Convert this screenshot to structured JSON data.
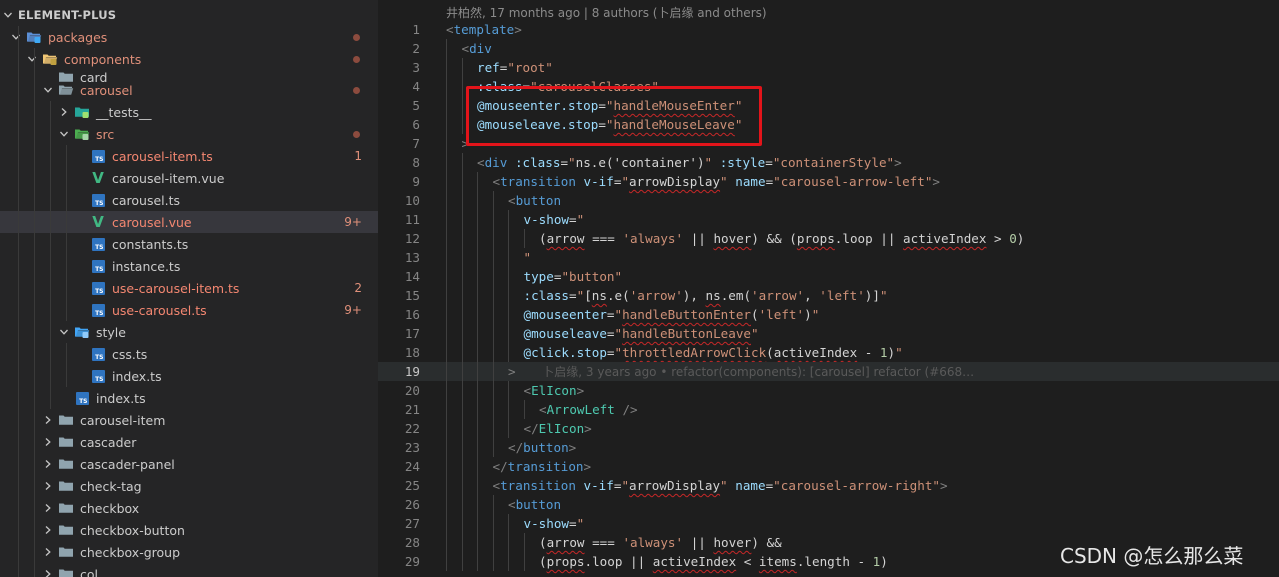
{
  "explorer": {
    "rows": [
      {
        "label": "ELEMENT-PLUS",
        "type": "root",
        "depth": 0,
        "chevron": "down",
        "icon": "none",
        "status": "none",
        "badge": ""
      },
      {
        "label": "packages",
        "type": "folder",
        "depth": 1,
        "chevron": "down",
        "icon": "folder-packages-icon",
        "status": "modified",
        "badge": "dot"
      },
      {
        "label": "components",
        "type": "folder",
        "depth": 2,
        "chevron": "down",
        "icon": "folder-components-icon",
        "status": "modified",
        "badge": "dot"
      },
      {
        "label": "card",
        "type": "folder",
        "depth": 3,
        "chevron": "none",
        "icon": "folder-icon",
        "status": "none",
        "badge": ""
      },
      {
        "label": "carousel",
        "type": "folder",
        "depth": 3,
        "chevron": "down",
        "icon": "folder-open-icon",
        "status": "modified",
        "badge": "dot"
      },
      {
        "label": "__tests__",
        "type": "folder",
        "depth": 4,
        "chevron": "right",
        "icon": "folder-tests-icon",
        "status": "none",
        "badge": ""
      },
      {
        "label": "src",
        "type": "folder",
        "depth": 4,
        "chevron": "down",
        "icon": "folder-src-icon",
        "status": "modified",
        "badge": "dot"
      },
      {
        "label": "carousel-item.ts",
        "type": "file",
        "depth": 5,
        "chevron": "none",
        "icon": "ts-icon",
        "status": "error",
        "badge": "1"
      },
      {
        "label": "carousel-item.vue",
        "type": "file",
        "depth": 5,
        "chevron": "none",
        "icon": "vue-icon",
        "status": "none",
        "badge": ""
      },
      {
        "label": "carousel.ts",
        "type": "file",
        "depth": 5,
        "chevron": "none",
        "icon": "ts-icon",
        "status": "none",
        "badge": ""
      },
      {
        "label": "carousel.vue",
        "type": "file",
        "depth": 5,
        "chevron": "none",
        "icon": "vue-icon",
        "status": "error",
        "badge": "9+",
        "selected": true
      },
      {
        "label": "constants.ts",
        "type": "file",
        "depth": 5,
        "chevron": "none",
        "icon": "ts-icon",
        "status": "none",
        "badge": ""
      },
      {
        "label": "instance.ts",
        "type": "file",
        "depth": 5,
        "chevron": "none",
        "icon": "ts-icon",
        "status": "none",
        "badge": ""
      },
      {
        "label": "use-carousel-item.ts",
        "type": "file",
        "depth": 5,
        "chevron": "none",
        "icon": "ts-icon",
        "status": "error",
        "badge": "2"
      },
      {
        "label": "use-carousel.ts",
        "type": "file",
        "depth": 5,
        "chevron": "none",
        "icon": "ts-icon",
        "status": "error",
        "badge": "9+"
      },
      {
        "label": "style",
        "type": "folder",
        "depth": 4,
        "chevron": "down",
        "icon": "folder-style-icon",
        "status": "none",
        "badge": ""
      },
      {
        "label": "css.ts",
        "type": "file",
        "depth": 5,
        "chevron": "none",
        "icon": "ts-icon",
        "status": "none",
        "badge": ""
      },
      {
        "label": "index.ts",
        "type": "file",
        "depth": 5,
        "chevron": "none",
        "icon": "ts-icon",
        "status": "none",
        "badge": ""
      },
      {
        "label": "index.ts",
        "type": "file",
        "depth": 4,
        "chevron": "none",
        "icon": "ts-icon",
        "status": "none",
        "badge": ""
      },
      {
        "label": "carousel-item",
        "type": "folder",
        "depth": 3,
        "chevron": "right",
        "icon": "folder-icon",
        "status": "none",
        "badge": ""
      },
      {
        "label": "cascader",
        "type": "folder",
        "depth": 3,
        "chevron": "right",
        "icon": "folder-icon",
        "status": "none",
        "badge": ""
      },
      {
        "label": "cascader-panel",
        "type": "folder",
        "depth": 3,
        "chevron": "right",
        "icon": "folder-icon",
        "status": "none",
        "badge": ""
      },
      {
        "label": "check-tag",
        "type": "folder",
        "depth": 3,
        "chevron": "right",
        "icon": "folder-icon",
        "status": "none",
        "badge": ""
      },
      {
        "label": "checkbox",
        "type": "folder",
        "depth": 3,
        "chevron": "right",
        "icon": "folder-icon",
        "status": "none",
        "badge": ""
      },
      {
        "label": "checkbox-button",
        "type": "folder",
        "depth": 3,
        "chevron": "right",
        "icon": "folder-icon",
        "status": "none",
        "badge": ""
      },
      {
        "label": "checkbox-group",
        "type": "folder",
        "depth": 3,
        "chevron": "right",
        "icon": "folder-icon",
        "status": "none",
        "badge": ""
      },
      {
        "label": "col",
        "type": "folder",
        "depth": 3,
        "chevron": "right",
        "icon": "folder-icon",
        "status": "none",
        "badge": ""
      }
    ]
  },
  "editor": {
    "blame_header": "井柏然, 17 months ago | 8 authors (卜启缘 and others)",
    "current_line": 19,
    "lines": [
      {
        "n": "1",
        "i": 0,
        "t": [
          [
            "p",
            "<"
          ],
          [
            "tag",
            "template"
          ],
          [
            "p",
            ">"
          ]
        ]
      },
      {
        "n": "2",
        "i": 1,
        "t": [
          [
            "p",
            "<"
          ],
          [
            "tag",
            "div"
          ]
        ]
      },
      {
        "n": "3",
        "i": 2,
        "t": [
          [
            "attr",
            "ref"
          ],
          [
            "plain",
            "="
          ],
          [
            "str",
            "\"root\""
          ]
        ]
      },
      {
        "n": "4",
        "i": 2,
        "t": [
          [
            "attr",
            ":class"
          ],
          [
            "plain",
            "="
          ],
          [
            "str",
            "\"carouselClasses\""
          ]
        ]
      },
      {
        "n": "5",
        "i": 2,
        "t": [
          [
            "attr",
            "@mouseenter.stop"
          ],
          [
            "plain",
            "="
          ],
          [
            "str",
            "\""
          ],
          [
            "fnsq",
            "handleMouseEnter"
          ],
          [
            "str",
            "\""
          ]
        ]
      },
      {
        "n": "6",
        "i": 2,
        "t": [
          [
            "attr",
            "@mouseleave.stop"
          ],
          [
            "plain",
            "="
          ],
          [
            "str",
            "\""
          ],
          [
            "fnsq",
            "handleMouseLeave"
          ],
          [
            "str",
            "\""
          ]
        ]
      },
      {
        "n": "7",
        "i": 1,
        "t": [
          [
            "p",
            ">"
          ]
        ]
      },
      {
        "n": "8",
        "i": 2,
        "t": [
          [
            "p",
            "<"
          ],
          [
            "tag",
            "div"
          ],
          [
            "plain",
            " "
          ],
          [
            "attr",
            ":class"
          ],
          [
            "plain",
            "="
          ],
          [
            "str",
            "\""
          ],
          [
            "plain",
            "ns.e('container')"
          ],
          [
            "str",
            "\""
          ],
          [
            "plain",
            " "
          ],
          [
            "attr",
            ":style"
          ],
          [
            "plain",
            "="
          ],
          [
            "str",
            "\"containerStyle\""
          ],
          [
            "p",
            ">"
          ]
        ]
      },
      {
        "n": "9",
        "i": 3,
        "t": [
          [
            "p",
            "<"
          ],
          [
            "tag",
            "transition"
          ],
          [
            "plain",
            " "
          ],
          [
            "attr",
            "v-if"
          ],
          [
            "plain",
            "="
          ],
          [
            "str",
            "\""
          ],
          [
            "plainsq",
            "arrowDisplay"
          ],
          [
            "str",
            "\""
          ],
          [
            "plain",
            " "
          ],
          [
            "attr",
            "name"
          ],
          [
            "plain",
            "="
          ],
          [
            "str",
            "\"carousel-arrow-left\""
          ],
          [
            "p",
            ">"
          ]
        ]
      },
      {
        "n": "10",
        "i": 4,
        "t": [
          [
            "p",
            "<"
          ],
          [
            "tag",
            "button"
          ]
        ]
      },
      {
        "n": "11",
        "i": 5,
        "t": [
          [
            "attr",
            "v-show"
          ],
          [
            "plain",
            "="
          ],
          [
            "str",
            "\""
          ]
        ]
      },
      {
        "n": "12",
        "i": 6,
        "t": [
          [
            "plain",
            "("
          ],
          [
            "plainsq",
            "arrow"
          ],
          [
            "plain",
            " === "
          ],
          [
            "str",
            "'always'"
          ],
          [
            "plain",
            " || "
          ],
          [
            "plainsq",
            "hover"
          ],
          [
            "plain",
            ") && ("
          ],
          [
            "plainsq",
            "props"
          ],
          [
            "plain",
            ".loop || "
          ],
          [
            "plainsq",
            "activeIndex"
          ],
          [
            "plain",
            " > "
          ],
          [
            "num",
            "0"
          ],
          [
            "plain",
            ")"
          ]
        ]
      },
      {
        "n": "13",
        "i": 5,
        "t": [
          [
            "str",
            "\""
          ]
        ]
      },
      {
        "n": "14",
        "i": 5,
        "t": [
          [
            "attr",
            "type"
          ],
          [
            "plain",
            "="
          ],
          [
            "str",
            "\"button\""
          ]
        ]
      },
      {
        "n": "15",
        "i": 5,
        "t": [
          [
            "attr",
            ":class"
          ],
          [
            "plain",
            "="
          ],
          [
            "str",
            "\""
          ],
          [
            "plain",
            "["
          ],
          [
            "plainsq",
            "ns"
          ],
          [
            "plain",
            ".e("
          ],
          [
            "str",
            "'arrow'"
          ],
          [
            "plain",
            "), "
          ],
          [
            "plainsq",
            "ns"
          ],
          [
            "plain",
            ".em("
          ],
          [
            "str",
            "'arrow'"
          ],
          [
            "plain",
            ", "
          ],
          [
            "str",
            "'left'"
          ],
          [
            "plain",
            ")]"
          ],
          [
            "str",
            "\""
          ]
        ]
      },
      {
        "n": "16",
        "i": 5,
        "t": [
          [
            "attr",
            "@mouseenter"
          ],
          [
            "plain",
            "="
          ],
          [
            "str",
            "\""
          ],
          [
            "fnsq",
            "handleButtonEnter"
          ],
          [
            "plain",
            "("
          ],
          [
            "str",
            "'left'"
          ],
          [
            "plain",
            ")"
          ],
          [
            "str",
            "\""
          ]
        ]
      },
      {
        "n": "17",
        "i": 5,
        "t": [
          [
            "attr",
            "@mouseleave"
          ],
          [
            "plain",
            "="
          ],
          [
            "str",
            "\""
          ],
          [
            "fnsq",
            "handleButtonLeave"
          ],
          [
            "str",
            "\""
          ]
        ]
      },
      {
        "n": "18",
        "i": 5,
        "t": [
          [
            "attr",
            "@click.stop"
          ],
          [
            "plain",
            "="
          ],
          [
            "str",
            "\""
          ],
          [
            "fnsq",
            "throttledArrowClick"
          ],
          [
            "plain",
            "("
          ],
          [
            "plainsq",
            "activeIndex"
          ],
          [
            "plain",
            " - "
          ],
          [
            "num",
            "1"
          ],
          [
            "plain",
            ")"
          ],
          [
            "str",
            "\""
          ]
        ]
      },
      {
        "n": "19",
        "i": 4,
        "t": [
          [
            "p",
            ">"
          ],
          [
            "blame",
            "       卜启缘, 3 years ago • refactor(components): [carousel] refactor (#668…"
          ]
        ]
      },
      {
        "n": "20",
        "i": 5,
        "t": [
          [
            "p",
            "<"
          ],
          [
            "comp",
            "ElIcon"
          ],
          [
            "p",
            ">"
          ]
        ]
      },
      {
        "n": "21",
        "i": 6,
        "t": [
          [
            "p",
            "<"
          ],
          [
            "comp",
            "ArrowLeft"
          ],
          [
            "plain",
            " "
          ],
          [
            "p",
            "/>"
          ]
        ]
      },
      {
        "n": "22",
        "i": 5,
        "t": [
          [
            "p",
            "</"
          ],
          [
            "comp",
            "ElIcon"
          ],
          [
            "p",
            ">"
          ]
        ]
      },
      {
        "n": "23",
        "i": 4,
        "t": [
          [
            "p",
            "</"
          ],
          [
            "tag",
            "button"
          ],
          [
            "p",
            ">"
          ]
        ]
      },
      {
        "n": "24",
        "i": 3,
        "t": [
          [
            "p",
            "</"
          ],
          [
            "tag",
            "transition"
          ],
          [
            "p",
            ">"
          ]
        ]
      },
      {
        "n": "25",
        "i": 3,
        "t": [
          [
            "p",
            "<"
          ],
          [
            "tag",
            "transition"
          ],
          [
            "plain",
            " "
          ],
          [
            "attr",
            "v-if"
          ],
          [
            "plain",
            "="
          ],
          [
            "str",
            "\""
          ],
          [
            "plainsq",
            "arrowDisplay"
          ],
          [
            "str",
            "\""
          ],
          [
            "plain",
            " "
          ],
          [
            "attr",
            "name"
          ],
          [
            "plain",
            "="
          ],
          [
            "str",
            "\"carousel-arrow-right\""
          ],
          [
            "p",
            ">"
          ]
        ]
      },
      {
        "n": "26",
        "i": 4,
        "t": [
          [
            "p",
            "<"
          ],
          [
            "tag",
            "button"
          ]
        ]
      },
      {
        "n": "27",
        "i": 5,
        "t": [
          [
            "attr",
            "v-show"
          ],
          [
            "plain",
            "="
          ],
          [
            "str",
            "\""
          ]
        ]
      },
      {
        "n": "28",
        "i": 6,
        "t": [
          [
            "plain",
            "("
          ],
          [
            "plainsq",
            "arrow"
          ],
          [
            "plain",
            " === "
          ],
          [
            "str",
            "'always'"
          ],
          [
            "plain",
            " || "
          ],
          [
            "plainsq",
            "hover"
          ],
          [
            "plain",
            ") &&"
          ]
        ]
      },
      {
        "n": "29",
        "i": 6,
        "t": [
          [
            "plain",
            "("
          ],
          [
            "plainsq",
            "props"
          ],
          [
            "plain",
            ".loop || "
          ],
          [
            "plainsq",
            "activeIndex"
          ],
          [
            "plain",
            " < "
          ],
          [
            "plainsq",
            "items"
          ],
          [
            "plain",
            ".length - "
          ],
          [
            "num",
            "1"
          ],
          [
            "plain",
            ")"
          ]
        ]
      }
    ]
  },
  "watermark": "CSDN @怎么那么菜",
  "colors": {
    "sidebar_bg": "#252526",
    "editor_bg": "#1e1e1e",
    "highlight_box": "#e3141a",
    "error_text": "#f48771",
    "modified_text": "#e0907a"
  }
}
